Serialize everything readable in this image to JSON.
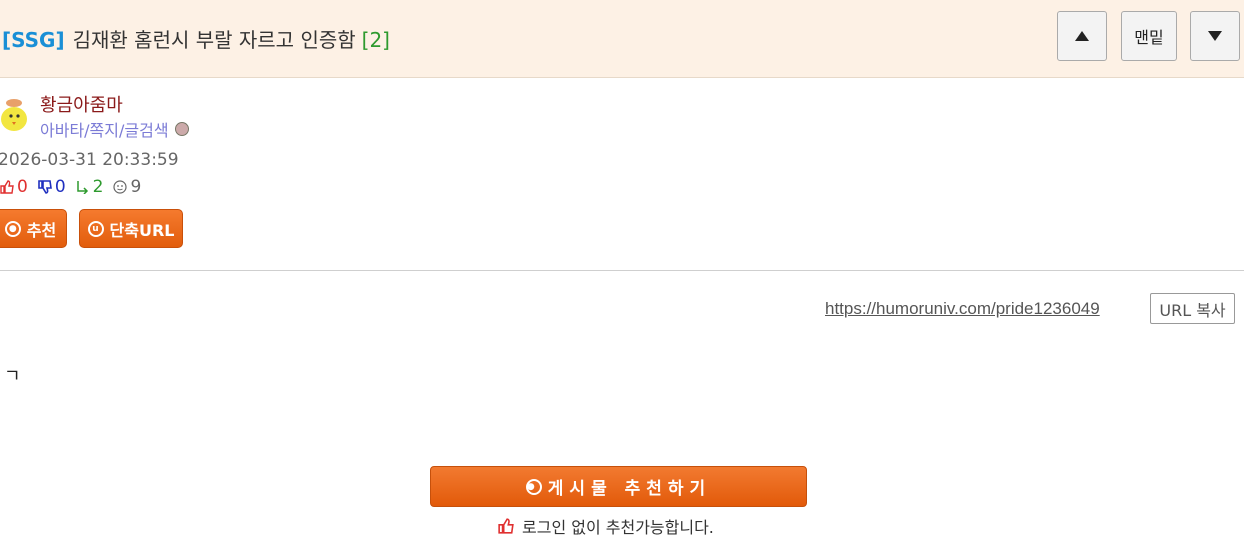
{
  "header": {
    "tag": "[SSG]",
    "title": "김재환 홈런시 부랄 자르고 인증함",
    "comment_count": "[2]",
    "btn_top_icon": "triangle-up-icon",
    "btn_bottom_label": "맨밑",
    "btn_down_icon": "triangle-down-icon"
  },
  "author": {
    "name": "황금아줌마",
    "links": "아바타/쪽지/글검색",
    "avatar_icon": "chick-avatar-icon"
  },
  "post": {
    "date": "2026-03-31 20:33:59",
    "likes": "0",
    "dislikes": "0",
    "shares": "2",
    "views": "9",
    "body": "ㄱ"
  },
  "actions": {
    "recommend_label": "추천",
    "short_url_label": "단축URL",
    "url": "https://humoruniv.com/pride1236049",
    "url_copy_label": "URL 복사",
    "big_recommend_label": "게시물 추천하기",
    "login_note": "로그인 없이 추천가능합니다."
  },
  "colors": {
    "accent": "#e8620f",
    "header_bg": "#fdf1e5",
    "tag": "#1a8fd6",
    "author": "#8b1a1a"
  }
}
